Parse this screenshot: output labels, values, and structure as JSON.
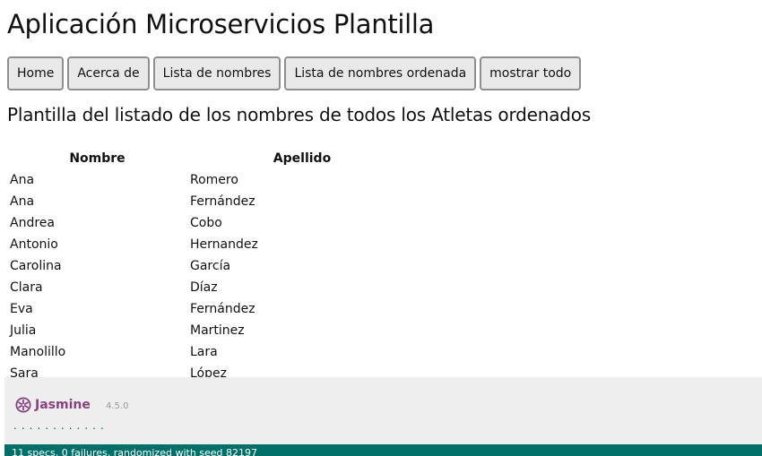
{
  "app": {
    "title": "Aplicación Microservicios Plantilla"
  },
  "nav": {
    "buttons": [
      "Home",
      "Acerca de",
      "Lista de nombres",
      "Lista de nombres ordenada",
      "mostrar todo"
    ]
  },
  "section": {
    "title": "Plantilla del listado de los nombres de todos los Atletas ordenados"
  },
  "table": {
    "headers": [
      "Nombre",
      "Apellido"
    ],
    "rows": [
      [
        "Ana",
        "Romero"
      ],
      [
        "Ana",
        "Fernández"
      ],
      [
        "Andrea",
        "Cobo"
      ],
      [
        "Antonio",
        "Hernandez"
      ],
      [
        "Carolina",
        "García"
      ],
      [
        "Clara",
        "Díaz"
      ],
      [
        "Eva",
        "Fernández"
      ],
      [
        "Julia",
        "Martinez"
      ],
      [
        "Manolillo",
        "Lara"
      ],
      [
        "Sara",
        "López"
      ]
    ]
  },
  "jasmine": {
    "brand": "Jasmine",
    "version": "4.5.0",
    "dots": "............",
    "status": "11 specs, 0 failures, randomized with seed 82197",
    "colors": {
      "brand": "#8a4182",
      "passed": "#007069"
    }
  }
}
